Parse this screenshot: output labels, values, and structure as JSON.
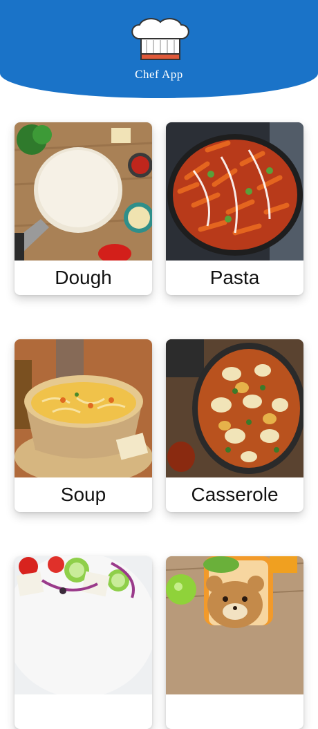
{
  "app": {
    "title": "Chef App",
    "theme_color": "#1a73c8",
    "logo_icon": "chef-hat-icon"
  },
  "categories": [
    {
      "label": "Dough",
      "image": "pizza-dough-photo"
    },
    {
      "label": "Pasta",
      "image": "penne-pasta-photo"
    },
    {
      "label": "Soup",
      "image": "noodle-soup-photo"
    },
    {
      "label": "Casserole",
      "image": "ravioli-casserole-photo"
    },
    {
      "label": "",
      "image": "greek-salad-photo"
    },
    {
      "label": "",
      "image": "kids-lunch-photo"
    }
  ]
}
